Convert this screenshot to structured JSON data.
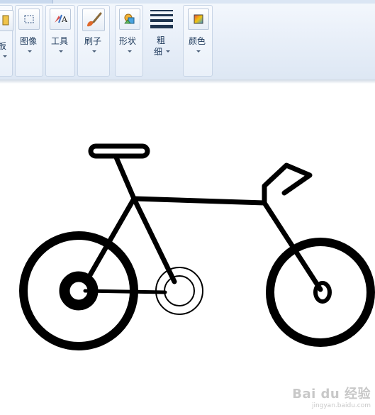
{
  "ribbon": {
    "groups": [
      {
        "label": "板",
        "has_caret": true
      },
      {
        "label": "图像",
        "has_caret": true
      },
      {
        "label": "工具",
        "has_caret": true
      },
      {
        "label": "刷子",
        "has_caret": true
      },
      {
        "label": "形状",
        "has_caret": true
      },
      {
        "label": "粗",
        "label2": "细",
        "has_caret": true
      },
      {
        "label": "颜色",
        "has_caret": true
      }
    ]
  },
  "canvas": {
    "drawing": "bicycle",
    "stroke_color": "#000000",
    "background": "#ffffff"
  },
  "watermark": {
    "brand": "Bai du 经验",
    "url": "jingyan.baidu.com"
  },
  "colors": {
    "ribbon_bg": "#e7eef8",
    "ribbon_text": "#1e395b",
    "group_border": "#c7d4e6"
  }
}
